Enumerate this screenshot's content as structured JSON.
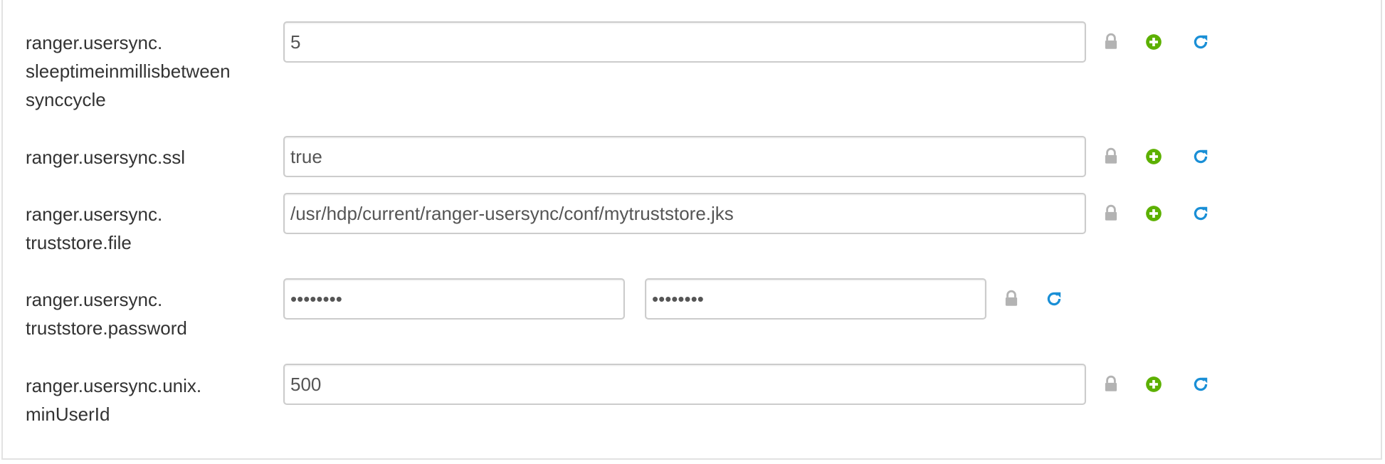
{
  "properties": [
    {
      "name": "ranger.usersync.\nsleeptimeinmillisbetween\nsynccycle",
      "value": "5",
      "type": "text"
    },
    {
      "name": "ranger.usersync.ssl",
      "value": "true",
      "type": "text"
    },
    {
      "name": "ranger.usersync.\ntruststore.file",
      "value": "/usr/hdp/current/ranger-usersync/conf/mytruststore.jks",
      "type": "text"
    },
    {
      "name": "ranger.usersync.\ntruststore.password",
      "value": "••••••••",
      "confirm_value": "••••••••",
      "type": "password"
    },
    {
      "name": "ranger.usersync.unix.\nminUserId",
      "value": "500",
      "type": "text"
    }
  ],
  "icons": {
    "lock": "lock-icon",
    "override": "plus-circle-icon",
    "refresh": "refresh-icon"
  },
  "colors": {
    "lock": "#b3b3b3",
    "override": "#5cb000",
    "refresh": "#1a8fd6",
    "border": "#cccccc",
    "text": "#333333"
  }
}
